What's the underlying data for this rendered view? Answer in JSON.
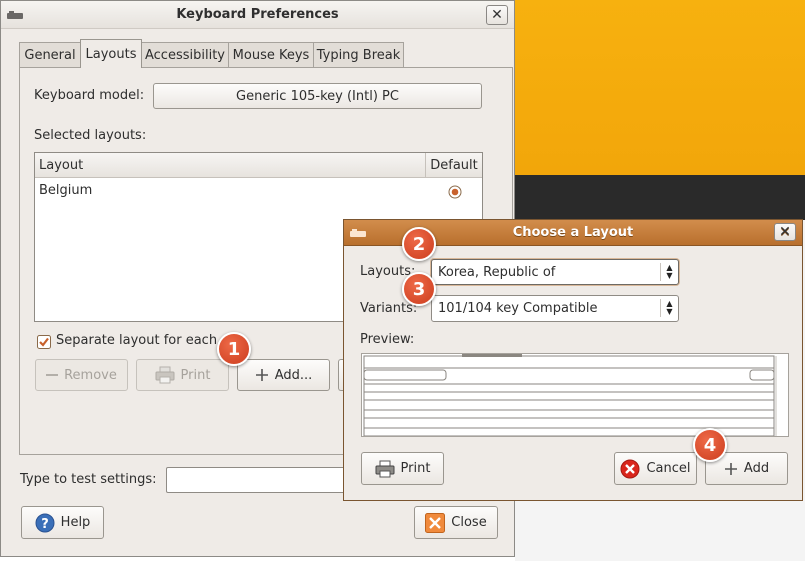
{
  "main_window": {
    "title": "Keyboard Preferences",
    "tabs": [
      {
        "label": "General"
      },
      {
        "label": "Layouts"
      },
      {
        "label": "Accessibility"
      },
      {
        "label": "Mouse Keys"
      },
      {
        "label": "Typing Break"
      }
    ],
    "keyboard_model_label": "Keyboard model:",
    "keyboard_model_value": "Generic 105-key (Intl) PC",
    "selected_layouts_label": "Selected layouts:",
    "layout_table": {
      "columns": [
        "Layout",
        "Default"
      ],
      "rows": [
        {
          "layout": "Belgium",
          "default": true
        }
      ]
    },
    "separate_layout_checkbox": {
      "label": "Separate layout for each window",
      "visible_label": "Separate layout for each",
      "checked": true
    },
    "remove_button": "Remove",
    "print_button": "Print",
    "add_button": "Add...",
    "type_to_test_label": "Type to test settings:",
    "help_button": "Help",
    "close_button": "Close"
  },
  "dialog": {
    "title": "Choose a Layout",
    "layouts_label": "Layouts:",
    "layouts_value": "Korea, Republic of",
    "variants_label": "Variants:",
    "variants_value": "101/104 key Compatible",
    "preview_label": "Preview:",
    "print_button": "Print",
    "cancel_button": "Cancel",
    "add_button": "Add"
  },
  "badges": [
    "1",
    "2",
    "3",
    "4"
  ],
  "colors": {
    "desktop_orange": "#f2a60a",
    "dialog_title": "#c17a38",
    "badge": "#d64a2a",
    "window_bg": "#efebe7"
  }
}
